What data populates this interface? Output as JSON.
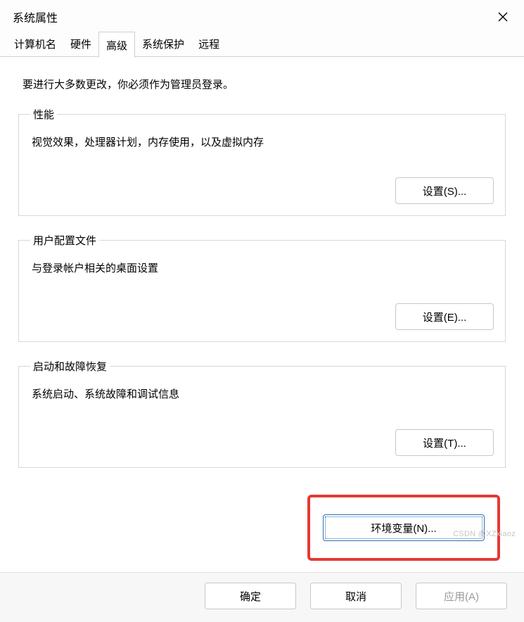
{
  "window": {
    "title": "系统属性"
  },
  "tabs": {
    "items": [
      {
        "label": "计算机名",
        "active": false
      },
      {
        "label": "硬件",
        "active": false
      },
      {
        "label": "高级",
        "active": true
      },
      {
        "label": "系统保护",
        "active": false
      },
      {
        "label": "远程",
        "active": false
      }
    ]
  },
  "intro": "要进行大多数更改，你必须作为管理员登录。",
  "groups": {
    "performance": {
      "legend": "性能",
      "desc": "视觉效果，处理器计划，内存使用，以及虚拟内存",
      "button": "设置(S)..."
    },
    "userProfiles": {
      "legend": "用户配置文件",
      "desc": "与登录帐户相关的桌面设置",
      "button": "设置(E)..."
    },
    "startupRecovery": {
      "legend": "启动和故障恢复",
      "desc": "系统启动、系统故障和调试信息",
      "button": "设置(T)..."
    }
  },
  "envButton": "环境变量(N)...",
  "footer": {
    "ok": "确定",
    "cancel": "取消",
    "apply": "应用(A)"
  },
  "watermark": "CSDN @XZxiaoz"
}
